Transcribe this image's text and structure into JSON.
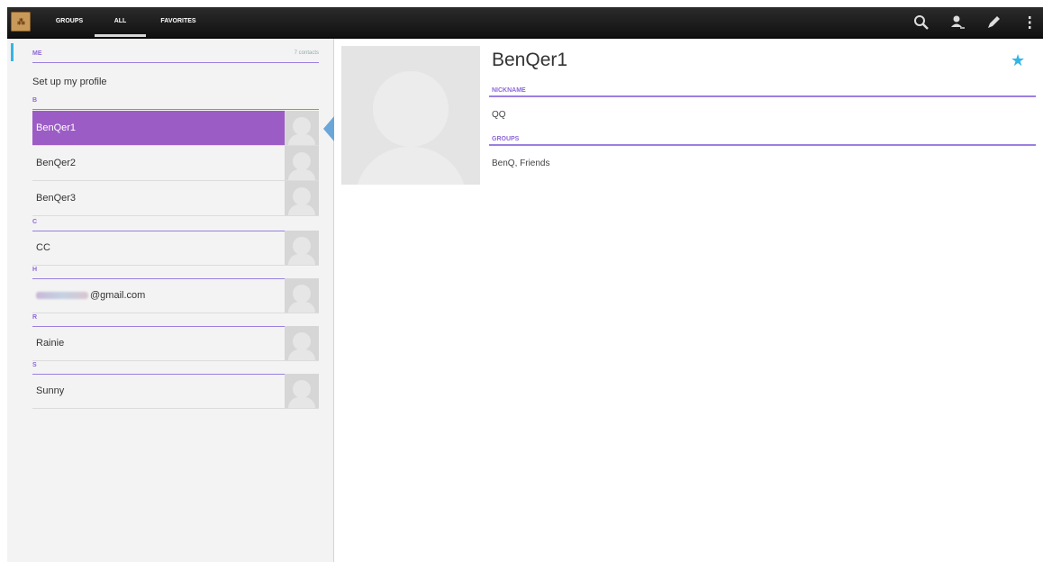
{
  "tabs": {
    "groups": "GROUPS",
    "all": "ALL",
    "favorites": "FAVORITES"
  },
  "list": {
    "me_header": "ME",
    "contact_count": "7 contacts",
    "profile_label": "Set up my profile",
    "sections": [
      {
        "letter": "B",
        "contacts": [
          "BenQer1",
          "BenQer2",
          "BenQer3"
        ]
      },
      {
        "letter": "C",
        "contacts": [
          "CC"
        ]
      },
      {
        "letter": "H",
        "contacts": [
          "@gmail.com"
        ]
      },
      {
        "letter": "R",
        "contacts": [
          "Rainie"
        ]
      },
      {
        "letter": "S",
        "contacts": [
          "Sunny"
        ]
      }
    ],
    "selected": "BenQer1"
  },
  "detail": {
    "name": "BenQer1",
    "nickname_label": "NICKNAME",
    "nickname_value": "QQ",
    "groups_label": "GROUPS",
    "groups_value": "BenQ, Friends",
    "starred": true
  },
  "icons": {
    "app": "contacts-app-icon",
    "search": "search-icon",
    "add": "add-contact-icon",
    "edit": "edit-icon",
    "overflow": "overflow-menu-icon",
    "star": "star-icon"
  },
  "colors": {
    "accent": "#33b5e5",
    "section": "#8e68d8",
    "selection": "#9c5cc5"
  }
}
